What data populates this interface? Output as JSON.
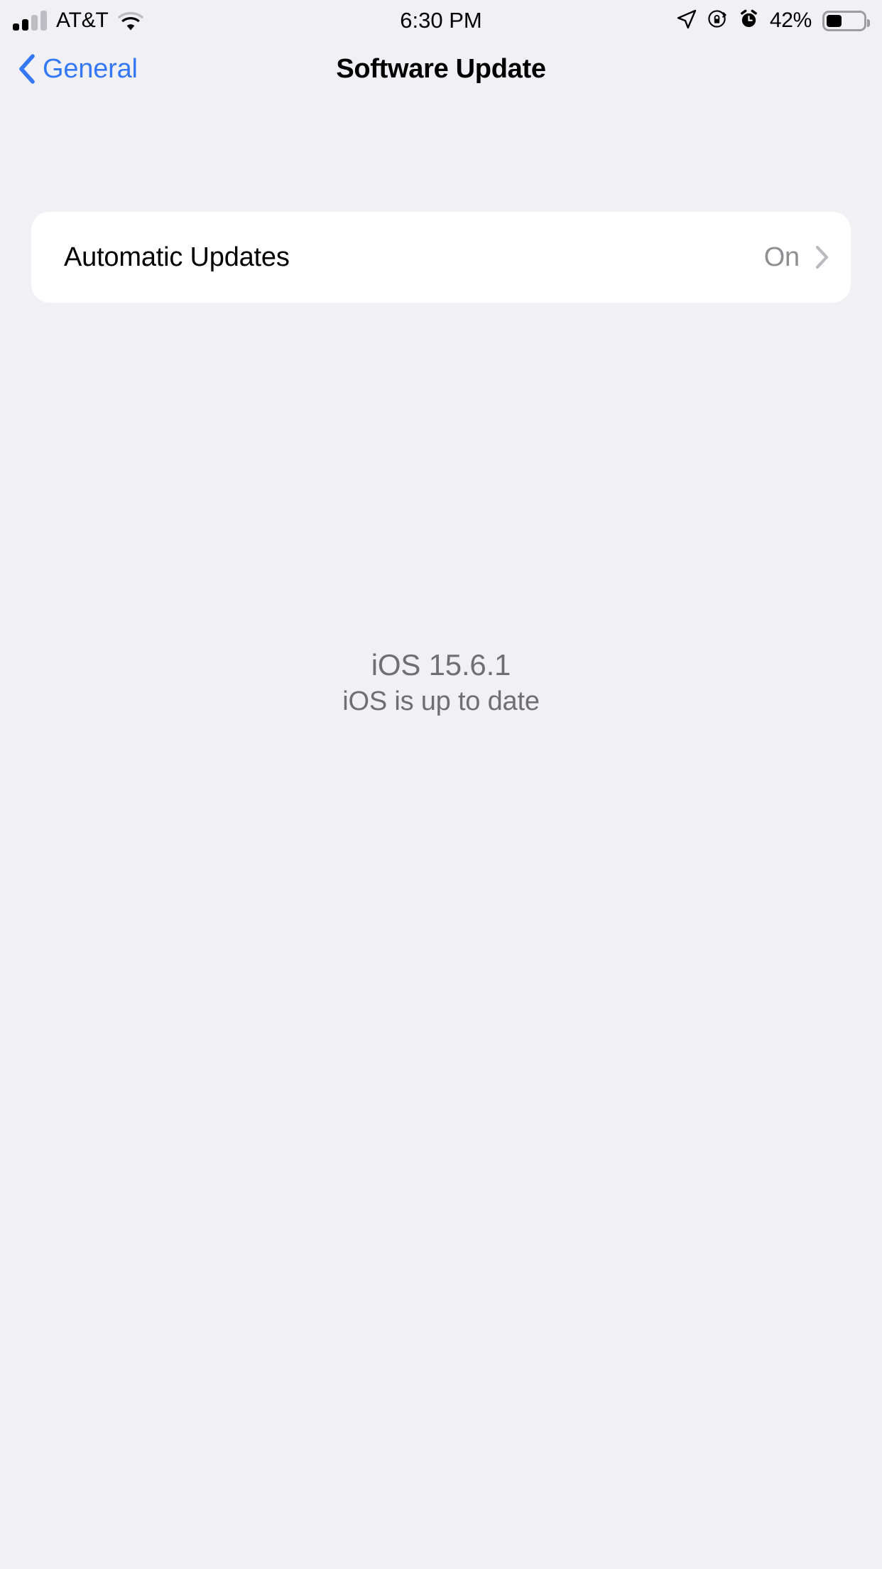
{
  "status_bar": {
    "carrier": "AT&T",
    "time": "6:30 PM",
    "battery_percent": "42%",
    "battery_level": 42,
    "icons": {
      "signal": "cellular-signal-icon",
      "wifi": "wifi-icon",
      "location": "location-arrow-icon",
      "rotation_lock": "rotation-lock-icon",
      "alarm": "alarm-clock-icon",
      "battery": "battery-icon"
    }
  },
  "nav_bar": {
    "back_label": "General",
    "title": "Software Update",
    "back_icon": "chevron-left-icon"
  },
  "settings_list": {
    "rows": [
      {
        "label": "Automatic Updates",
        "value": "On",
        "accessory": "chevron-right-icon"
      }
    ]
  },
  "version_info": {
    "version": "iOS 15.6.1",
    "status": "iOS is up to date"
  },
  "colors": {
    "background": "#F1F1F5",
    "card": "#FFFFFF",
    "accent_blue": "#3478F6",
    "secondary_text": "#8E8E93",
    "version_text": "#6E6E73",
    "primary_text": "#000000"
  }
}
